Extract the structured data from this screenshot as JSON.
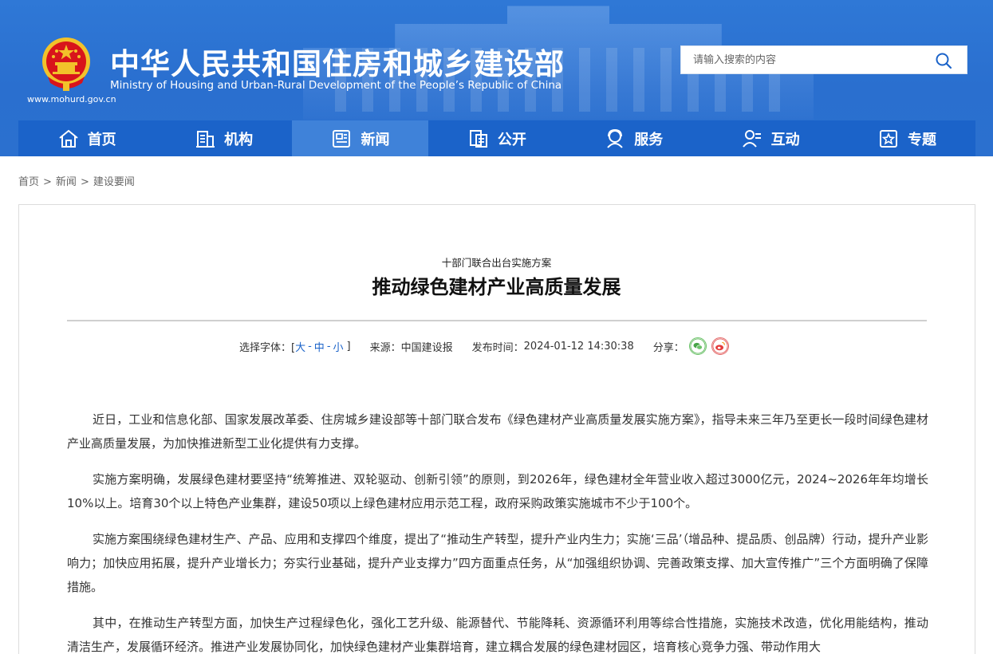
{
  "header": {
    "title": "中华人民共和国住房和城乡建设部",
    "subtitle": "Ministry of Housing and Urban-Rural Development of the People’s Republic of China",
    "domain": "www.mohurd.gov.cn",
    "search_placeholder": "请输入搜索的内容",
    "emblem_icon": "national-emblem-icon",
    "search_icon": "search-icon",
    "colors": {
      "header_blue": "#2b70cf",
      "nav_blue": "#1b63c9",
      "nav_active": "#3f82d9",
      "emblem_red": "#d8141b",
      "emblem_gold": "#f2c22a"
    }
  },
  "nav": {
    "items": [
      {
        "label": "首页",
        "icon": "home-icon"
      },
      {
        "label": "机构",
        "icon": "building-icon"
      },
      {
        "label": "新闻",
        "icon": "news-icon",
        "active": true
      },
      {
        "label": "公开",
        "icon": "disclosure-icon"
      },
      {
        "label": "服务",
        "icon": "service-icon"
      },
      {
        "label": "互动",
        "icon": "interaction-icon"
      },
      {
        "label": "专题",
        "icon": "topic-icon"
      }
    ]
  },
  "breadcrumb": {
    "items": [
      "首页",
      "新闻",
      "建设要闻"
    ],
    "separator": ">"
  },
  "article": {
    "kicker": "十部门联合出台实施方案",
    "title": "推动绿色建材产业高质量发展",
    "meta": {
      "font_label": "选择字体：[",
      "font_large": "大",
      "font_medium": "中",
      "font_small": "小",
      "font_dash": "-",
      "font_close": "]",
      "source_label": "来源：",
      "source": "中国建设报",
      "time_label": "发布时间：",
      "time": "2024-01-12 14:30:38",
      "share_label": "分享：",
      "share_wechat_icon": "wechat-icon",
      "share_weibo_icon": "weibo-icon"
    },
    "paragraphs": [
      "近日，工业和信息化部、国家发展改革委、住房城乡建设部等十部门联合发布《绿色建材产业高质量发展实施方案》，指导未来三年乃至更长一段时间绿色建材产业高质量发展，为加快推进新型工业化提供有力支撑。",
      "实施方案明确，发展绿色建材要坚持“统筹推进、双轮驱动、创新引领”的原则，到2026年，绿色建材全年营业收入超过3000亿元，2024~2026年年均增长10%以上。培育30个以上特色产业集群，建设50项以上绿色建材应用示范工程，政府采购政策实施城市不少于100个。",
      "实施方案围绕绿色建材生产、产品、应用和支撑四个维度，提出了“推动生产转型，提升产业内生力；实施‘三品’（增品种、提品质、创品牌）行动，提升产业影响力；加快应用拓展，提升产业增长力；夯实行业基础，提升产业支撑力”四方面重点任务，从“加强组织协调、完善政策支撑、加大宣传推广”三个方面明确了保障措施。",
      "其中，在推动生产转型方面，加快生产过程绿色化，强化工艺升级、能源替代、节能降耗、资源循环利用等综合性措施，实施技术改造，优化用能结构，推动清洁生产，发展循环经济。推进产业发展协同化，加快绿色建材产业集群培育，建立耦合发展的绿色建材园区，培育核心竞争力强、带动作用大"
    ]
  }
}
